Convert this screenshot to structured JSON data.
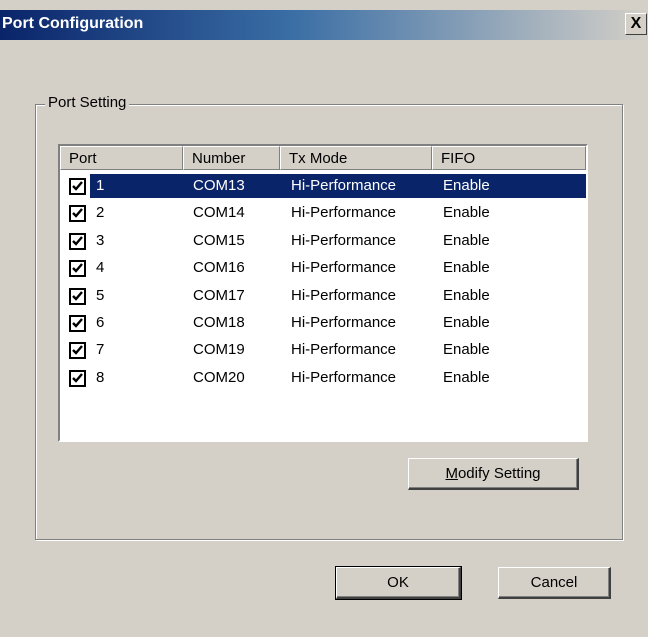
{
  "window": {
    "title": "Port Configuration",
    "close_label": "X"
  },
  "group": {
    "label": "Port Setting"
  },
  "table": {
    "columns": [
      "Port",
      "Number",
      "Tx Mode",
      "FIFO"
    ],
    "rows": [
      {
        "port": "1",
        "number": "COM13",
        "tx_mode": "Hi-Performance",
        "fifo": "Enable",
        "checked": true,
        "selected": true
      },
      {
        "port": "2",
        "number": "COM14",
        "tx_mode": "Hi-Performance",
        "fifo": "Enable",
        "checked": true,
        "selected": false
      },
      {
        "port": "3",
        "number": "COM15",
        "tx_mode": "Hi-Performance",
        "fifo": "Enable",
        "checked": true,
        "selected": false
      },
      {
        "port": "4",
        "number": "COM16",
        "tx_mode": "Hi-Performance",
        "fifo": "Enable",
        "checked": true,
        "selected": false
      },
      {
        "port": "5",
        "number": "COM17",
        "tx_mode": "Hi-Performance",
        "fifo": "Enable",
        "checked": true,
        "selected": false
      },
      {
        "port": "6",
        "number": "COM18",
        "tx_mode": "Hi-Performance",
        "fifo": "Enable",
        "checked": true,
        "selected": false
      },
      {
        "port": "7",
        "number": "COM19",
        "tx_mode": "Hi-Performance",
        "fifo": "Enable",
        "checked": true,
        "selected": false
      },
      {
        "port": "8",
        "number": "COM20",
        "tx_mode": "Hi-Performance",
        "fifo": "Enable",
        "checked": true,
        "selected": false
      }
    ]
  },
  "buttons": {
    "modify_mnemonic": "M",
    "modify_rest": "odify Setting",
    "ok": "OK",
    "cancel": "Cancel"
  },
  "colors": {
    "face": "#d4d0c8",
    "selection": "#0a246a",
    "title_gradient_start": "#0a246a"
  },
  "icons": {
    "close": "close-icon",
    "checkbox": "checkmark-icon"
  }
}
